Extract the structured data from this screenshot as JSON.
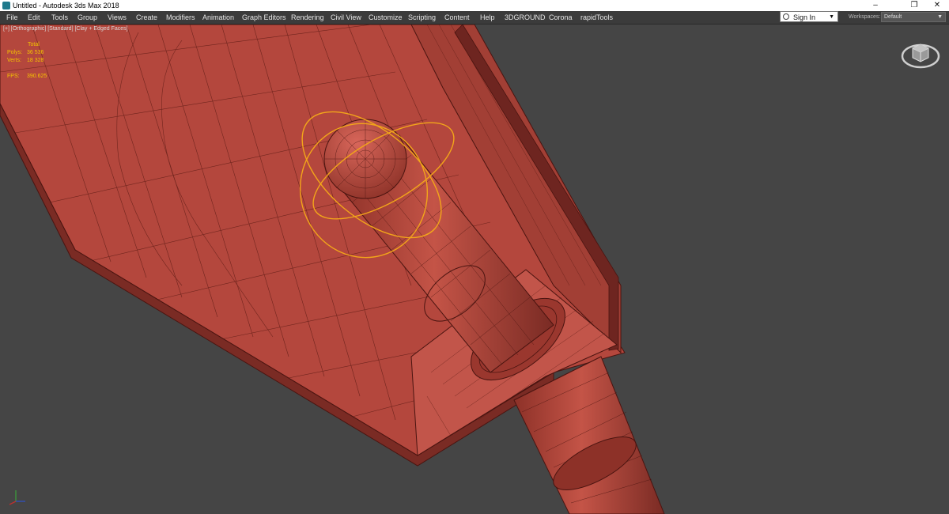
{
  "window": {
    "title": "Untitled - Autodesk 3ds Max 2018",
    "controls": {
      "minimize": "–",
      "maximize": "❐",
      "close": "✕"
    }
  },
  "menu": {
    "items": [
      "File",
      "Edit",
      "Tools",
      "Group",
      "Views",
      "Create",
      "Modifiers",
      "Animation",
      "Graph Editors",
      "Rendering",
      "Civil View",
      "Customize",
      "Scripting",
      "Content",
      "Help",
      "3DGROUND",
      "Corona",
      "rapidTools"
    ]
  },
  "header": {
    "signin_label": "Sign In",
    "workspaces_label": "Workspaces:",
    "workspace_value": "Default"
  },
  "viewport": {
    "label": "[+] [Orthographic] [Standard] [Clay + Edged Faces]",
    "stats": {
      "total_label": "Total",
      "polys_label": "Polys:",
      "polys_value": "36 536",
      "verts_label": "Verts:",
      "verts_value": "18 328",
      "fps_label": "FPS:",
      "fps_value": "390.625"
    },
    "colors": {
      "background": "#454545",
      "model_face": "#b4473d",
      "model_dark": "#7a2b24",
      "wire": "#4a1410",
      "selection": "#f2a51a",
      "stats_text": "#f5c400"
    }
  }
}
